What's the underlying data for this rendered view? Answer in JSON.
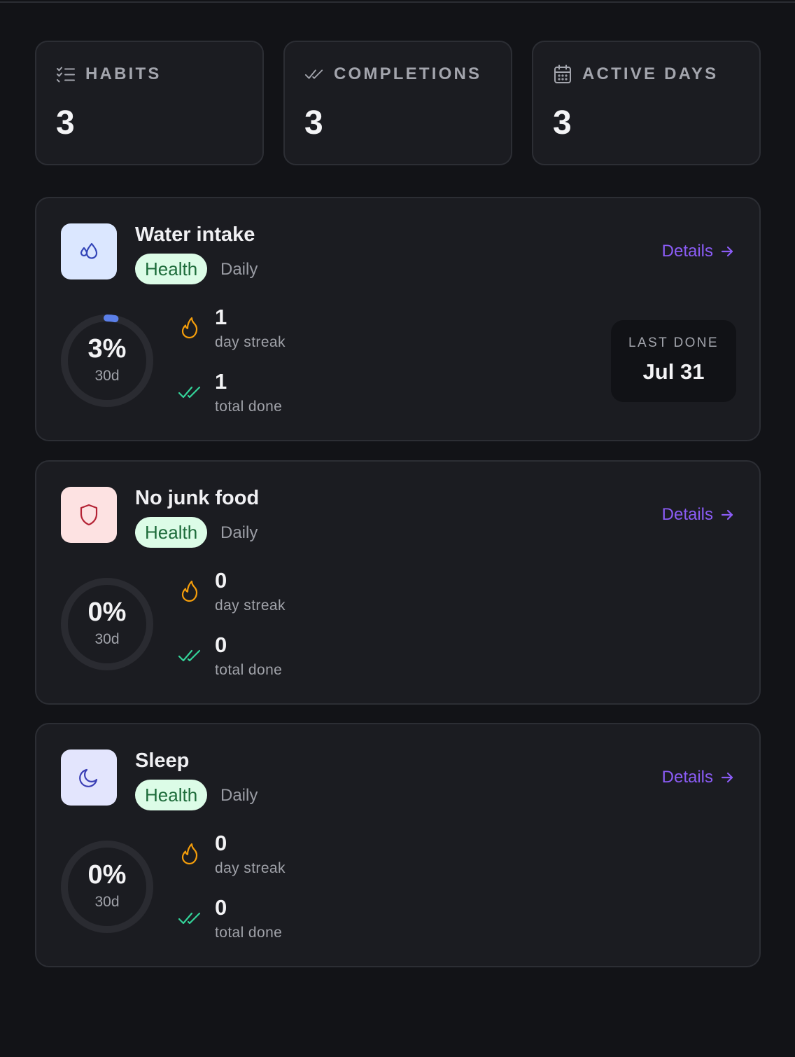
{
  "stats": [
    {
      "label": "HABITS",
      "value": "3",
      "icon": "checklist-icon"
    },
    {
      "label": "COMPLETIONS",
      "value": "3",
      "icon": "double-check-icon"
    },
    {
      "label": "ACTIVE DAYS",
      "value": "3",
      "icon": "calendar-icon"
    }
  ],
  "habits": [
    {
      "name": "Water intake",
      "tag": "Health",
      "frequency": "Daily",
      "details_label": "Details",
      "icon": "water-drops-icon",
      "percent": "3%",
      "percent_value": 0.03,
      "window": "30d",
      "streak": "1",
      "streak_label": "day streak",
      "total": "1",
      "total_label": "total done",
      "last_done_label": "LAST DONE",
      "last_done_value": "Jul 31"
    },
    {
      "name": "No junk food",
      "tag": "Health",
      "frequency": "Daily",
      "details_label": "Details",
      "icon": "shield-icon",
      "percent": "0%",
      "percent_value": 0,
      "window": "30d",
      "streak": "0",
      "streak_label": "day streak",
      "total": "0",
      "total_label": "total done"
    },
    {
      "name": "Sleep",
      "tag": "Health",
      "frequency": "Daily",
      "details_label": "Details",
      "icon": "moon-icon",
      "percent": "0%",
      "percent_value": 0,
      "window": "30d",
      "streak": "0",
      "streak_label": "day streak",
      "total": "0",
      "total_label": "total done"
    }
  ],
  "colors": {
    "accent": "#8b5cf6",
    "ring_progress": "#5b7fe8",
    "ring_track": "#2a2b31",
    "tag_bg": "#dcfce7",
    "tag_text": "#1d6b3a",
    "flame": "#f59e0b",
    "check": "#34d399"
  }
}
